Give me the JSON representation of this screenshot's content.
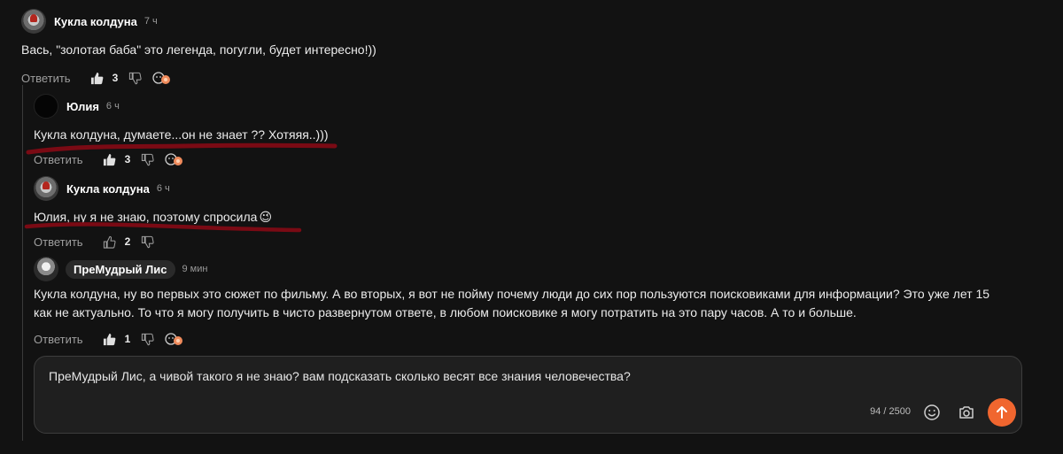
{
  "comments": [
    {
      "author": "Кукла колдуна",
      "time": "7 ч",
      "text": "Вась, \"золотая баба\" это легенда, погугли, будет интересно!))",
      "reply": "Ответить",
      "likes": "3"
    },
    {
      "author": "Юлия",
      "time": "6 ч",
      "text": "Кукла колдуна, думаете...он не знает ?? Хотяяя..)))",
      "reply": "Ответить",
      "likes": "3"
    },
    {
      "author": "Кукла колдуна",
      "time": "6 ч",
      "text": "Юлия, ну я не знаю, поэтому спросила",
      "emoji": "😉",
      "reply": "Ответить",
      "likes": "2"
    },
    {
      "author": "ПреМудрый Лис",
      "time": "9 мин",
      "text_line1": "Кукла колдуна, ну во первых это сюжет по фильму. А во вторых, я вот не пойму почему люди до сих пор пользуются поисковиками для информации? Это уже лет 15",
      "text_line2": "как не актуально. То что я могу получить в чисто развернутом ответе, в любом поисковике я могу потратить на это пару часов. А то и больше.",
      "reply": "Ответить",
      "likes": "1"
    }
  ],
  "composer": {
    "text": "ПреМудрый Лис, а чивой такого я не знаю? вам подсказать сколько весят все знания человечества?",
    "counter": "94 / 2500"
  },
  "colors": {
    "background": "#121212",
    "underline": "#7a0a14",
    "send_button": "#f0662f"
  },
  "icons": [
    "like-icon",
    "dislike-icon",
    "reactions-icon",
    "smile-icon",
    "camera-icon",
    "arrow-up-icon"
  ]
}
